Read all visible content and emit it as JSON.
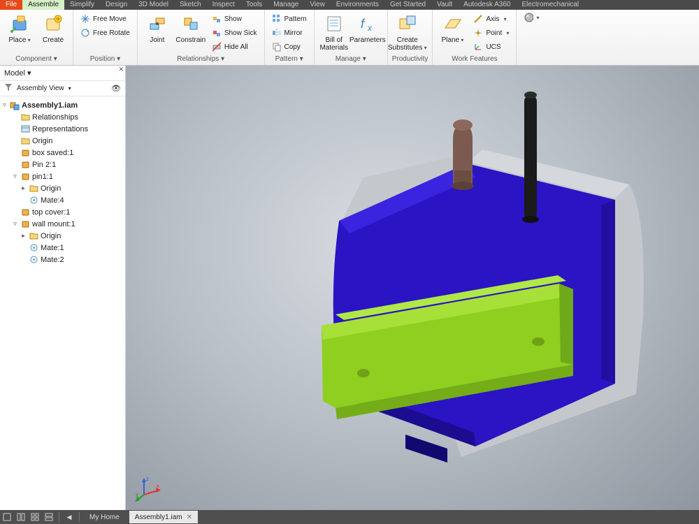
{
  "menubar": {
    "file": "File",
    "tabs": [
      "Assemble",
      "Simplify",
      "Design",
      "3D Model",
      "Sketch",
      "Inspect",
      "Tools",
      "Manage",
      "View",
      "Environments",
      "Get Started",
      "Vault",
      "Autodesk A360",
      "Electromechanical"
    ],
    "active": "Assemble"
  },
  "ribbon": {
    "component": {
      "label": "Component ▾",
      "place": "Place",
      "create": "Create"
    },
    "position": {
      "label": "Position ▾",
      "free_move": "Free Move",
      "free_rotate": "Free Rotate"
    },
    "relationships": {
      "label": "Relationships ▾",
      "joint": "Joint",
      "constrain": "Constrain",
      "show": "Show",
      "show_sick": "Show Sick",
      "hide_all": "Hide All"
    },
    "pattern": {
      "label": "Pattern ▾",
      "pattern": "Pattern",
      "mirror": "Mirror",
      "copy": "Copy"
    },
    "manage": {
      "label": "Manage ▾",
      "bom": "Bill of\nMaterials",
      "parameters": "Parameters"
    },
    "productivity": {
      "label": "Productivity",
      "create_subs": "Create\nSubstitutes"
    },
    "work_features": {
      "label": "Work Features",
      "plane": "Plane",
      "axis": "Axis",
      "point": "Point",
      "ucs": "UCS"
    }
  },
  "browser": {
    "title": "Model ▾",
    "view_label": "Assembly View",
    "root": "Assembly1.iam",
    "nodes": [
      {
        "indent": 1,
        "twisty": "",
        "icon": "folder",
        "text": "Relationships"
      },
      {
        "indent": 1,
        "twisty": "",
        "icon": "reps",
        "text": "Representations"
      },
      {
        "indent": 1,
        "twisty": "",
        "icon": "folder",
        "text": "Origin"
      },
      {
        "indent": 1,
        "twisty": "",
        "icon": "part",
        "text": "box saved:1"
      },
      {
        "indent": 1,
        "twisty": "",
        "icon": "part",
        "text": "Pin 2:1"
      },
      {
        "indent": 1,
        "twisty": "▿",
        "icon": "part",
        "text": "pin1:1"
      },
      {
        "indent": 2,
        "twisty": "▸",
        "icon": "folder",
        "text": "Origin"
      },
      {
        "indent": 2,
        "twisty": "",
        "icon": "mate",
        "text": "Mate:4"
      },
      {
        "indent": 1,
        "twisty": "",
        "icon": "part",
        "text": "top cover:1"
      },
      {
        "indent": 1,
        "twisty": "▿",
        "icon": "part",
        "text": "wall mount:1"
      },
      {
        "indent": 2,
        "twisty": "▸",
        "icon": "folder",
        "text": "Origin"
      },
      {
        "indent": 2,
        "twisty": "",
        "icon": "mate",
        "text": "Mate:1"
      },
      {
        "indent": 2,
        "twisty": "",
        "icon": "mate",
        "text": "Mate:2"
      }
    ]
  },
  "bottombar": {
    "home": "My Home",
    "doc": "Assembly1.iam"
  }
}
